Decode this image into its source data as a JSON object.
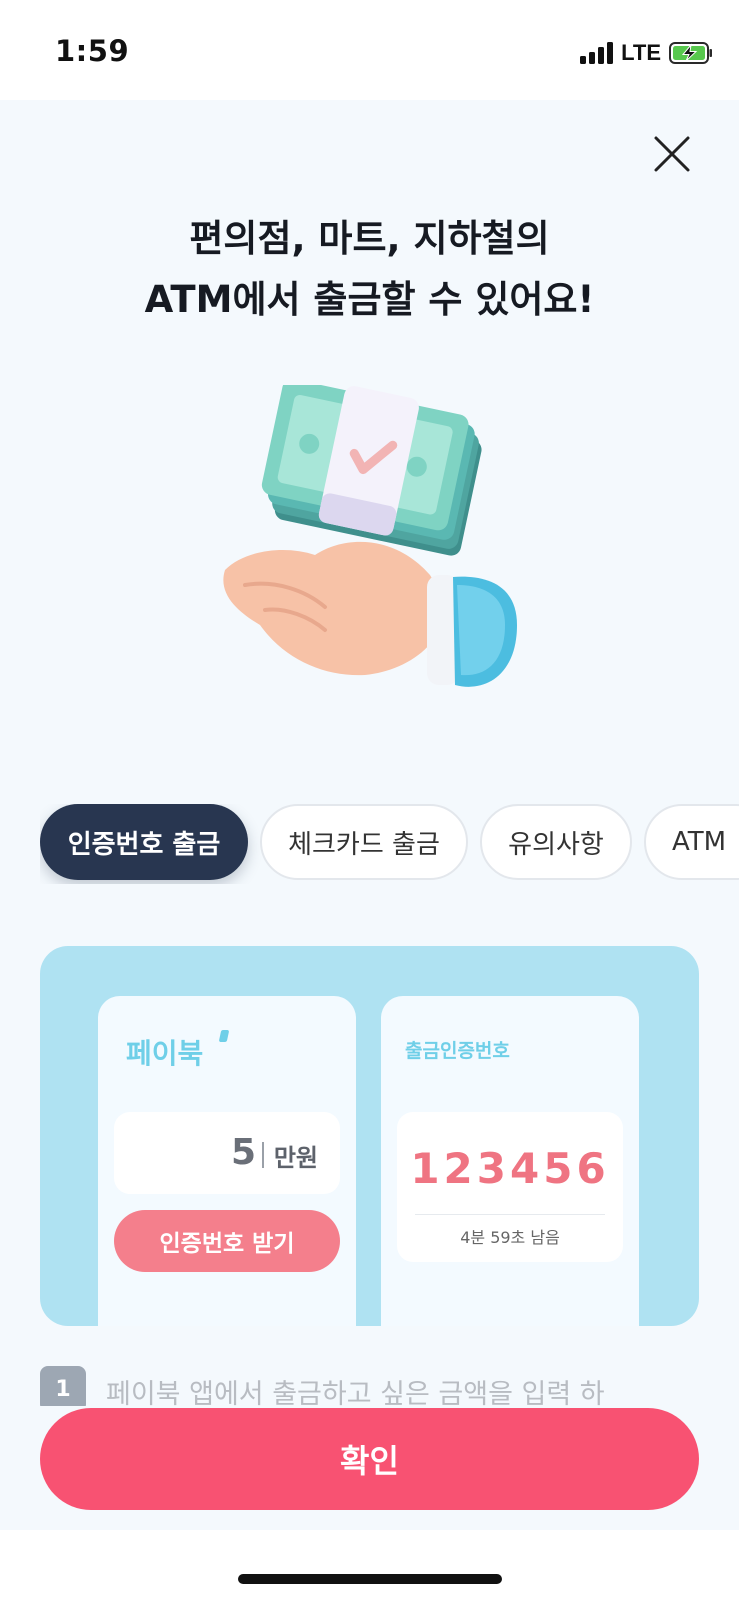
{
  "status_bar": {
    "time": "1:59",
    "network": "LTE"
  },
  "header": {
    "title_line1": "편의점, 마트, 지하철의",
    "title_line2": "ATM에서 출금할 수 있어요!"
  },
  "tabs": [
    {
      "label": "인증번호 출금",
      "active": true
    },
    {
      "label": "체크카드 출금",
      "active": false
    },
    {
      "label": "유의사항",
      "active": false
    },
    {
      "label": "ATM",
      "active": false
    }
  ],
  "guide": {
    "app_brand": "페이북",
    "amount_value": "5",
    "amount_unit": "만원",
    "get_code_label": "인증번호 받기",
    "code_title": "출금인증번호",
    "code_number": "123456",
    "code_timer": "4분 59초 남음"
  },
  "step": {
    "number": "1",
    "text": "페이북 앱에서 출금하고 싶은 금액을 입력 하"
  },
  "confirm_label": "확인",
  "colors": {
    "accent": "#f85272",
    "tab_active": "#283650",
    "panel": "#afe2f2",
    "code": "#ef7482"
  }
}
